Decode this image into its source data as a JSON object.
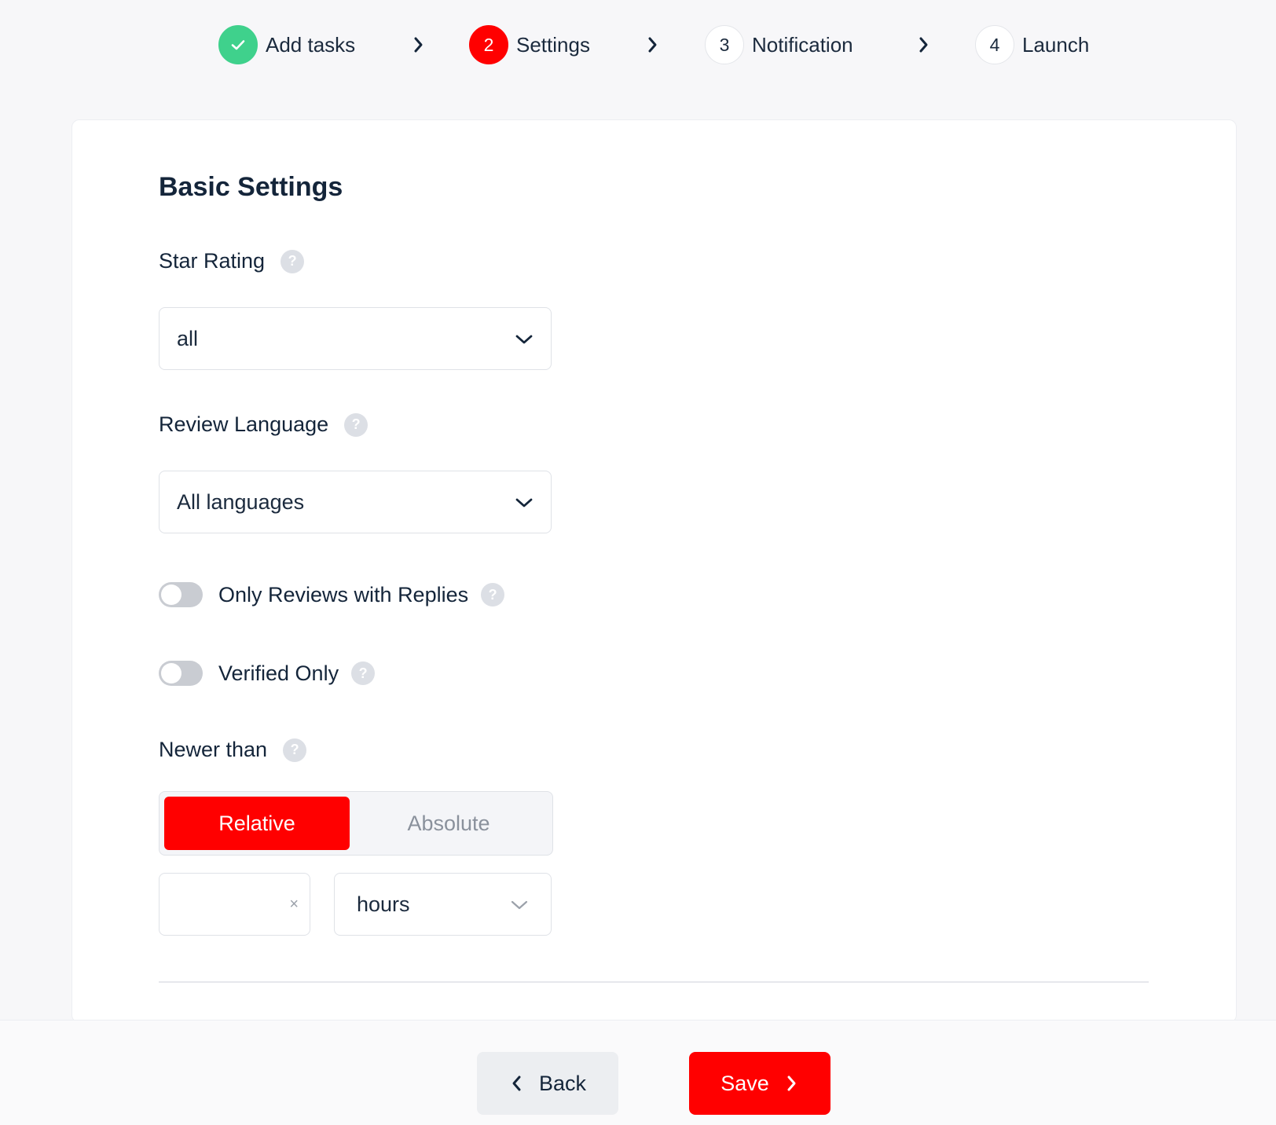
{
  "stepper": {
    "steps": [
      {
        "number": "",
        "label": "Add tasks",
        "state": "done"
      },
      {
        "number": "2",
        "label": "Settings",
        "state": "active"
      },
      {
        "number": "3",
        "label": "Notification",
        "state": "pending"
      },
      {
        "number": "4",
        "label": "Launch",
        "state": "pending"
      }
    ]
  },
  "card": {
    "title": "Basic Settings",
    "star_rating": {
      "label": "Star Rating",
      "help": "?",
      "value": "all"
    },
    "review_language": {
      "label": "Review Language",
      "help": "?",
      "value": "All languages"
    },
    "only_replies": {
      "label": "Only Reviews with Replies",
      "help": "?",
      "enabled": false
    },
    "verified_only": {
      "label": "Verified Only",
      "help": "?",
      "enabled": false
    },
    "newer_than": {
      "label": "Newer than",
      "help": "?",
      "modes": [
        "Relative",
        "Absolute"
      ],
      "active_mode": "Relative",
      "amount": "",
      "clear_symbol": "×",
      "unit": "hours"
    }
  },
  "footer": {
    "back_label": "Back",
    "save_label": "Save"
  },
  "colors": {
    "accent": "#ff0000",
    "success": "#3fd18c",
    "text": "#14253a"
  }
}
